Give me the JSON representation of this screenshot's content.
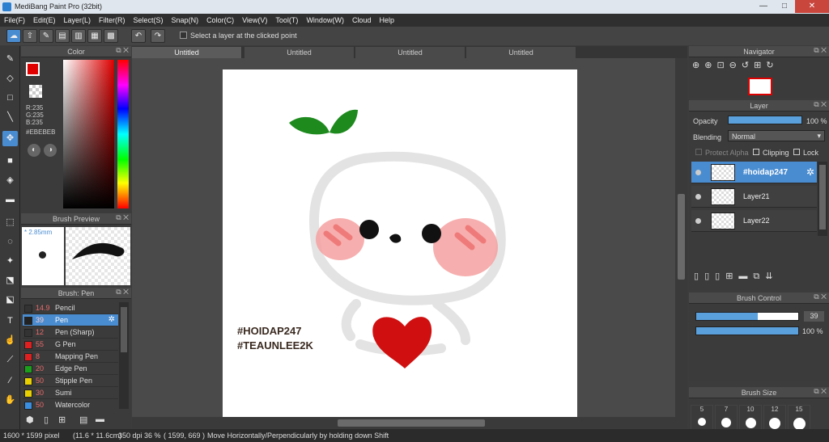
{
  "window": {
    "title": "MediBang Paint Pro (32bit)",
    "minimize": "—",
    "maximize": "□",
    "close": "✕"
  },
  "menu": [
    "File(F)",
    "Edit(E)",
    "Layer(L)",
    "Filter(R)",
    "Select(S)",
    "Snap(N)",
    "Color(C)",
    "View(V)",
    "Tool(T)",
    "Window(W)",
    "Cloud",
    "Help"
  ],
  "toolbar": {
    "checkbox_label": "Select a layer at the clicked point",
    "checked": false
  },
  "color_panel": {
    "title": "Color",
    "r": "R:235",
    "g": "G:235",
    "b": "B:235",
    "hex": "#EBEBEB",
    "fg_color": "#e00000"
  },
  "brush_preview": {
    "title": "Brush Preview",
    "size": "* 2.85mm"
  },
  "brush_panel": {
    "title": "Brush: Pen",
    "items": [
      {
        "size": "14.9",
        "name": "Pencil",
        "color": "#333333"
      },
      {
        "size": "39",
        "name": "Pen",
        "color": "#222222",
        "selected": true
      },
      {
        "size": "12",
        "name": "Pen (Sharp)",
        "color": "#333333"
      },
      {
        "size": "55",
        "name": "G Pen",
        "color": "#e02020"
      },
      {
        "size": "8",
        "name": "Mapping Pen",
        "color": "#e02020"
      },
      {
        "size": "20",
        "name": "Edge Pen",
        "color": "#1aa01a"
      },
      {
        "size": "50",
        "name": "Stipple Pen",
        "color": "#e8d000"
      },
      {
        "size": "30",
        "name": "Sumi",
        "color": "#e8d000"
      },
      {
        "size": "50",
        "name": "Watercolor",
        "color": "#3a8ee0"
      }
    ]
  },
  "tabs": [
    "Untitled",
    "Untitled",
    "Untitled",
    "Untitled"
  ],
  "canvas": {
    "text_line1": "#HOIDAP247",
    "text_line2": "#TEAUNLEE2K"
  },
  "navigator": {
    "title": "Navigator"
  },
  "layer_panel": {
    "title": "Layer",
    "opacity_label": "Opacity",
    "opacity_value": "100 %",
    "opacity": 1.0,
    "blending_label": "Blending",
    "blending_value": "Normal",
    "protect_alpha": "Protect Alpha",
    "clipping": "Clipping",
    "lock": "Lock",
    "layers": [
      {
        "name": "#hoidap247",
        "selected": true
      },
      {
        "name": "Layer21"
      },
      {
        "name": "Layer22"
      }
    ]
  },
  "brush_control": {
    "title": "Brush Control",
    "size_value": "39",
    "size_fraction": 0.6,
    "opacity_value": "100 %",
    "opacity_fraction": 1.0
  },
  "brush_size": {
    "title": "Brush Size",
    "sizes": [
      "5",
      "7",
      "10",
      "12",
      "15"
    ]
  },
  "status": {
    "dimensions": "1600 * 1599 pixel",
    "physical": "(11.6 * 11.6cm)",
    "dpi": "350 dpi",
    "zoom": "36 %",
    "coords": "( 1599, 669 )",
    "hint": "Move Horizontally/Perpendicularly by holding down Shift"
  }
}
